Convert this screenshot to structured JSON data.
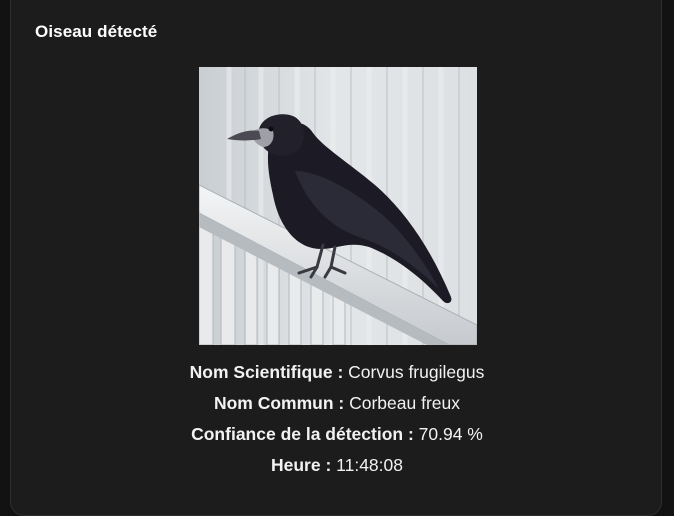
{
  "card": {
    "title": "Oiseau détecté"
  },
  "details": [
    {
      "label": "Nom Scientifique",
      "value": "Corvus frugilegus"
    },
    {
      "label": "Nom Commun",
      "value": "Corbeau freux"
    },
    {
      "label": "Confiance de la détection",
      "value": "70.94 %"
    },
    {
      "label": "Heure",
      "value": "11:48:08"
    }
  ],
  "theme": {
    "background": "#1c1c1c",
    "text": "#f2f2f2"
  }
}
